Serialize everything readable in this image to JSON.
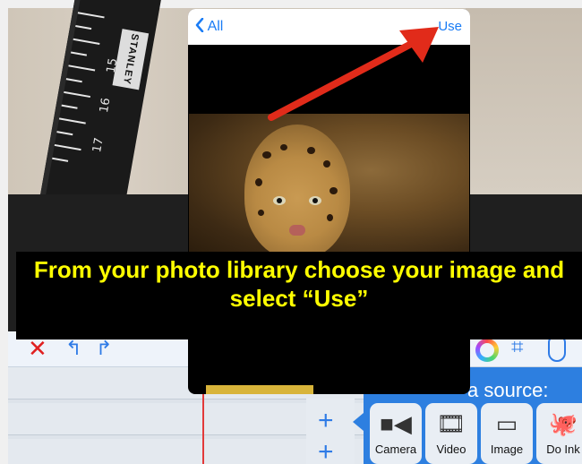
{
  "picker": {
    "back_label": "All",
    "back_icon": "chevron-left-icon",
    "use_label": "Use"
  },
  "caption": {
    "text": "From your photo library choose your image and select “Use”"
  },
  "background_photo": {
    "ruler_brand": "STANLEY",
    "ruler_numbers": [
      "15",
      "16",
      "17"
    ]
  },
  "toolbar": {
    "icons": [
      "close-icon",
      "undo-icon",
      "redo-icon",
      "color-wheel-icon",
      "crop-icon",
      "mask-icon"
    ]
  },
  "source_panel": {
    "title": "a source:",
    "buttons": [
      {
        "label": "Camera",
        "icon": "camera-icon"
      },
      {
        "label": "Video",
        "icon": "video-icon"
      },
      {
        "label": "Image",
        "icon": "image-icon"
      },
      {
        "label": "Do Ink",
        "icon": "octopus-icon"
      }
    ]
  },
  "colors": {
    "accent_blue": "#1a7cf5",
    "caption_yellow": "#ffff00",
    "arrow_red": "#e12b1a",
    "delete_red": "#e02020"
  }
}
